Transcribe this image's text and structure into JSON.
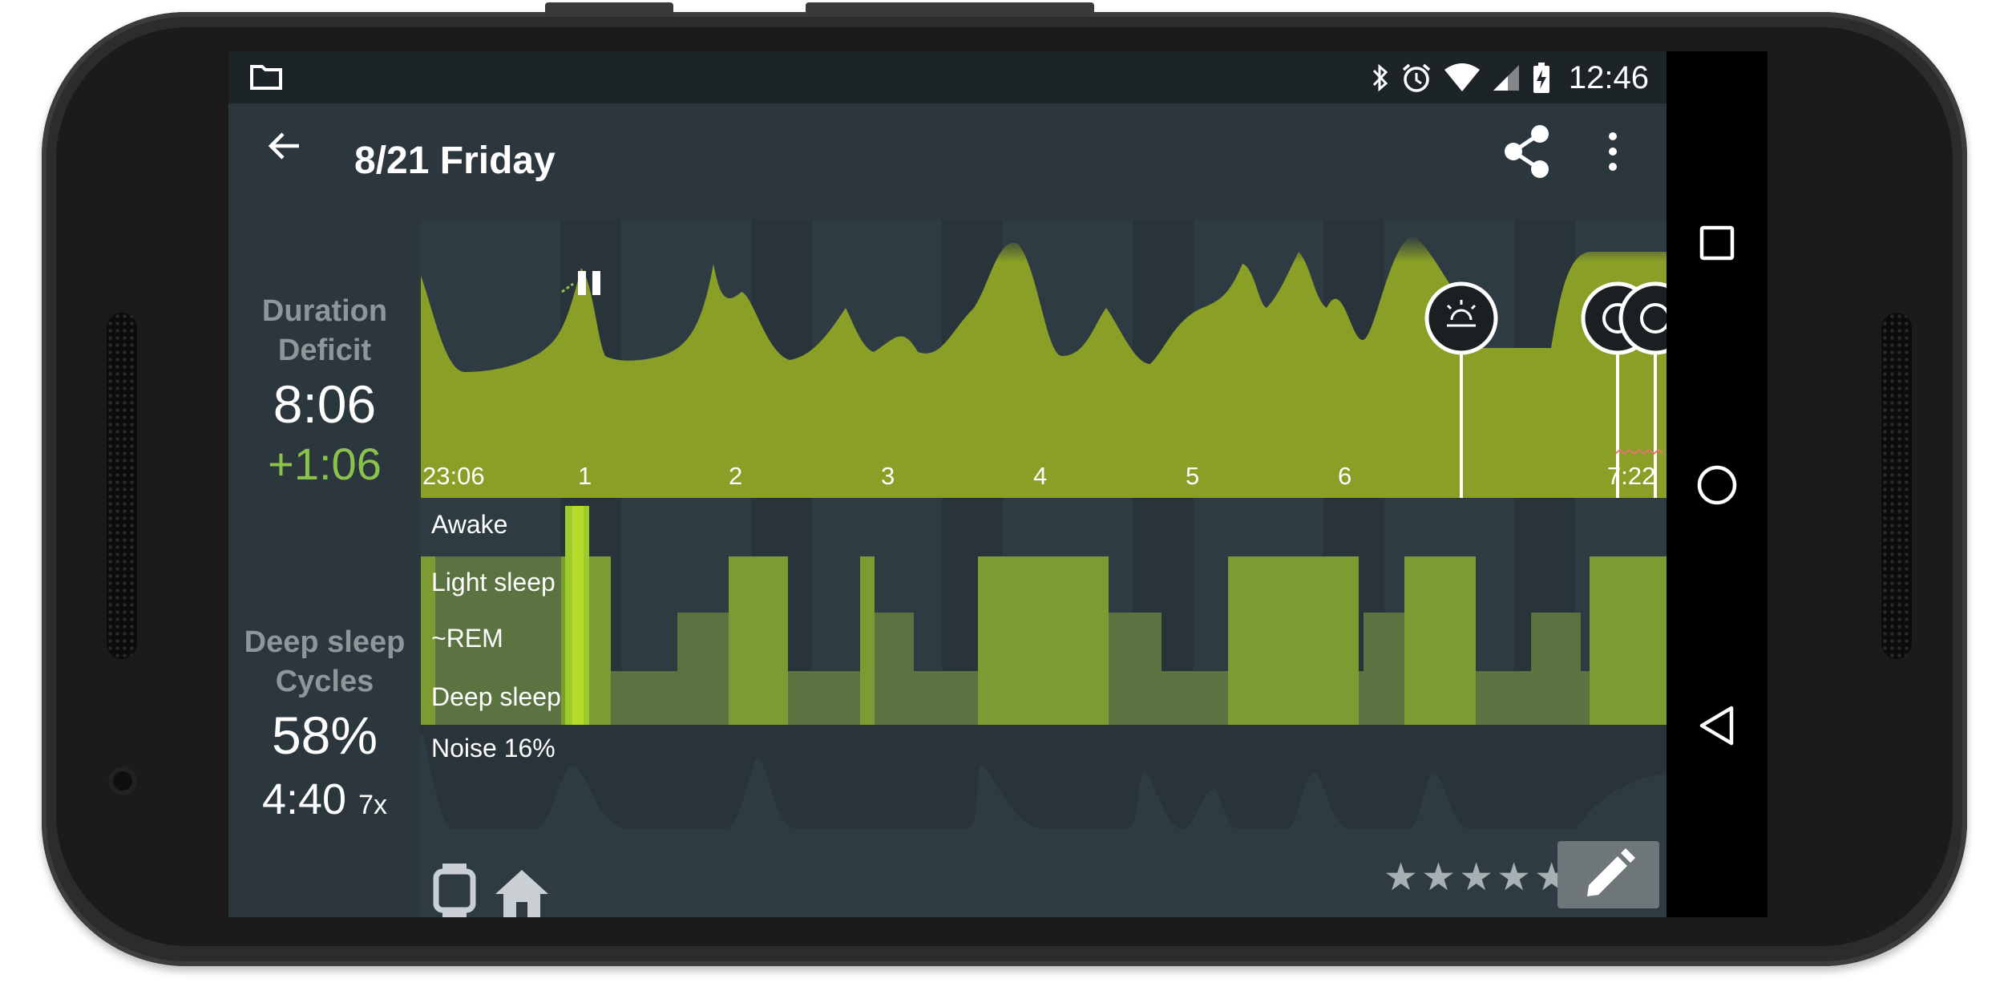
{
  "status_bar": {
    "time": "12:46",
    "icons": [
      "folder-icon",
      "bluetooth-icon",
      "alarm-icon",
      "wifi-icon",
      "signal-icon",
      "battery-charging-icon"
    ]
  },
  "header": {
    "title": "8/21 Friday",
    "actions": [
      "back-arrow-icon",
      "share-icon",
      "more-vert-icon"
    ]
  },
  "summary": {
    "duration_label_1": "Duration",
    "duration_label_2": "Deficit",
    "duration": "8:06",
    "deficit": "+1:06",
    "deep_label_1": "Deep sleep",
    "deep_label_2": "Cycles",
    "deep_percent": "58%",
    "deep_time": "4:40",
    "cycles": "7x"
  },
  "graph": {
    "start_time": "23:06",
    "hour_ticks": [
      "1",
      "2",
      "3",
      "4",
      "5",
      "6"
    ],
    "end_time": "7:22",
    "markers": [
      "alarm-sunrise-icon",
      "snooze-icon",
      "snooze-icon"
    ]
  },
  "hypnogram": {
    "stages": [
      "Awake",
      "Light sleep",
      "~REM",
      "Deep sleep"
    ],
    "noise_label": "Noise 16%"
  },
  "footer": {
    "tags": [
      "watch-icon",
      "home-icon"
    ],
    "rating_stars": 5,
    "rating_value": 0,
    "star_glyph": "★",
    "edit": "edit-pencil-icon"
  },
  "colors": {
    "accent_green": "#8bc34a",
    "graph_green": "#8a9f26",
    "panel_bg": "#2f3b42",
    "status_bar": "#1d2428"
  }
}
